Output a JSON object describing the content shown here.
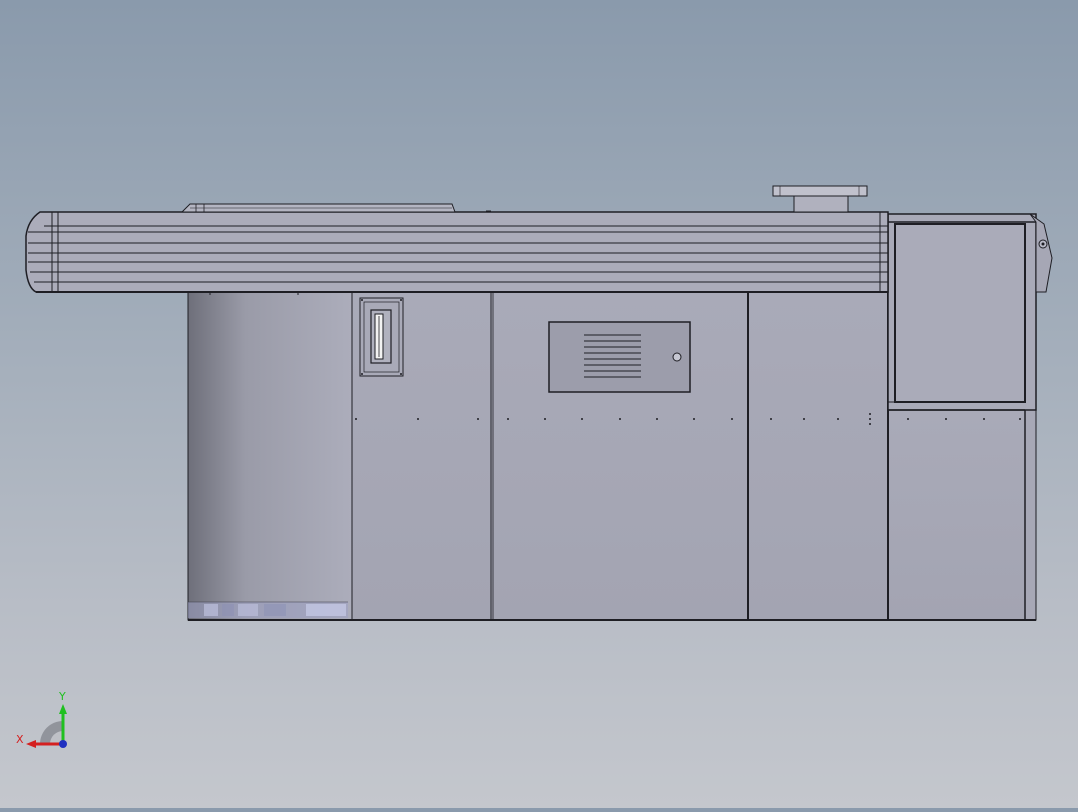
{
  "viewport": {
    "background_top": "#8a9aac",
    "background_bottom": "#c4c7cd",
    "model_fill": "#a8a9b8",
    "model_stroke": "#1e1e24"
  },
  "triad": {
    "x_label": "X",
    "y_label": "Y",
    "x_color": "#d42020",
    "y_color": "#20c020",
    "z_color": "#2030c0"
  }
}
